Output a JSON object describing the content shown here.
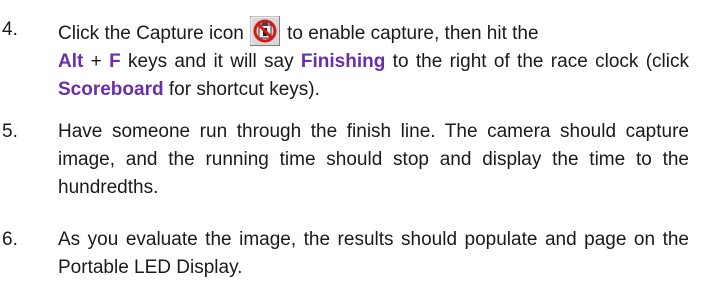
{
  "steps": [
    {
      "number": "4.",
      "parts": {
        "t1": "Click the Capture icon",
        "t2": "to enable capture, then hit the",
        "k1": "Alt",
        "t3": " + ",
        "k2": "F",
        "t4": " keys and it will say ",
        "k3": "Finishing",
        "t5": " to the right of the race clock (click ",
        "k4": "Scoreboard",
        "t6": " for shortcut keys)."
      },
      "icon": "capture-icon"
    },
    {
      "number": "5.",
      "text": "Have someone run through the finish line. The camera should capture image, and the running time should stop and display the time to the hundredths."
    },
    {
      "number": "6.",
      "text": "As you evaluate the image, the results should populate and page on the Portable LED Display."
    }
  ],
  "colors": {
    "highlight": "#6a2fa8",
    "text": "#1a1a1a",
    "icon_red": "#d81818"
  }
}
